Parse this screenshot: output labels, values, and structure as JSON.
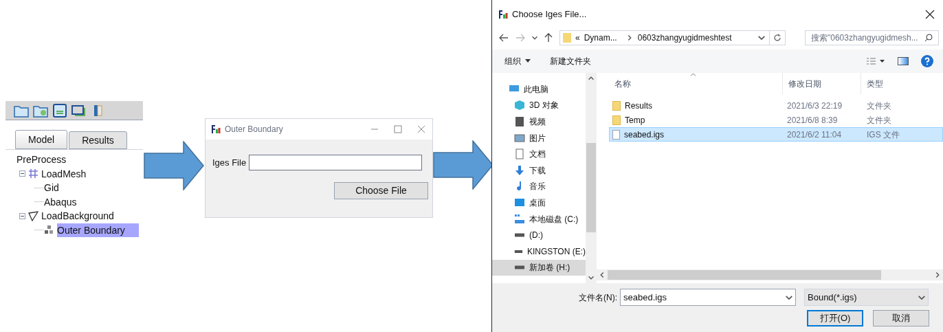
{
  "tree_panel": {
    "tabs": [
      {
        "label": "Model",
        "selected": true
      },
      {
        "label": "Results",
        "selected": false
      }
    ],
    "tree": [
      {
        "label": "PreProcess",
        "selected": false,
        "children": [
          {
            "label": "LoadMesh",
            "kind": "mesh",
            "selected": false,
            "expanded": true,
            "children": [
              {
                "label": "Gid",
                "selected": false
              },
              {
                "label": "Abaqus",
                "selected": false
              }
            ]
          },
          {
            "label": "LoadBackground",
            "kind": "background",
            "selected": false,
            "expanded": true,
            "children": [
              {
                "label": "Outer Boundary",
                "kind": "boundary",
                "selected": true
              }
            ]
          }
        ]
      }
    ]
  },
  "boundary_dialog": {
    "title": "Outer Boundary",
    "field_label": "Iges File",
    "button": "Choose File"
  },
  "file_dialog": {
    "title": "Choose Iges File...",
    "breadcrumb": [
      "«",
      "Dynam...",
      "0603zhangyugidmeshtest"
    ],
    "search": {
      "placeholder": "搜索\"0603zhangyugidmesh..."
    },
    "toolbar": [
      {
        "label": "组织",
        "dropdown": true
      },
      {
        "label": "新建文件夹",
        "dropdown": false
      }
    ],
    "nav_items": [
      {
        "label": "此电脑",
        "kind": "pc",
        "selected": false
      },
      {
        "label": "3D 对象",
        "kind": "objects3d",
        "selected": false
      },
      {
        "label": "视频",
        "kind": "video",
        "selected": false
      },
      {
        "label": "图片",
        "kind": "pictures",
        "selected": false
      },
      {
        "label": "文档",
        "kind": "documents",
        "selected": false
      },
      {
        "label": "下载",
        "kind": "downloads",
        "selected": false
      },
      {
        "label": "音乐",
        "kind": "music",
        "selected": false
      },
      {
        "label": "桌面",
        "kind": "desktop",
        "selected": false
      },
      {
        "label": "本地磁盘 (C:)",
        "kind": "system-drive",
        "selected": false
      },
      {
        "label": "(D:)",
        "kind": "drive",
        "selected": false
      },
      {
        "label": "KINGSTON (E:)",
        "kind": "drive",
        "selected": false
      },
      {
        "label": "新加卷 (H:)",
        "kind": "drive",
        "selected": true
      }
    ],
    "columns": [
      "名称",
      "修改日期",
      "类型"
    ],
    "files": [
      {
        "name": "Results",
        "date": "2021/6/3 22:19",
        "type": "文件夹",
        "kind": "folder",
        "selected": false
      },
      {
        "name": "Temp",
        "date": "2021/6/8 8:39",
        "type": "文件夹",
        "kind": "folder",
        "selected": false
      },
      {
        "name": "seabed.igs",
        "date": "2021/6/2 11:04",
        "type": "IGS 文件",
        "kind": "file",
        "selected": true
      }
    ],
    "filename_label": "文件名(N):",
    "filename": "seabed.igs",
    "filter": "Bound(*.igs)",
    "buttons": [
      {
        "label": "打开(O)",
        "default": true
      },
      {
        "label": "取消",
        "default": false
      }
    ]
  }
}
